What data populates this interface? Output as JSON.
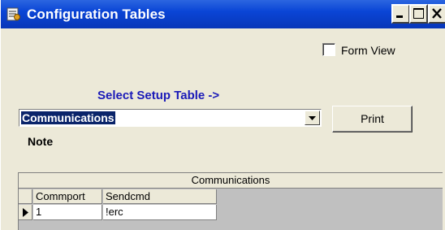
{
  "window": {
    "title": "Configuration Tables",
    "controls": {
      "minimize": "minimize",
      "maximize": "maximize",
      "close": "close"
    }
  },
  "form_view": {
    "label": "Form View",
    "checked": false
  },
  "setup": {
    "label": "Select Setup Table ->",
    "selected_value": "Communications"
  },
  "print_button": {
    "label": "Print"
  },
  "note": {
    "label": "Note"
  },
  "grid": {
    "caption": "Communications",
    "columns": [
      "Commport",
      "Sendcmd"
    ],
    "rows": [
      [
        "1",
        "!erc"
      ]
    ]
  },
  "colors": {
    "titlebar": "#0a45d6",
    "window_bg": "#ece9d8",
    "setup_label": "#1a1ab8",
    "selection": "#0a246a"
  },
  "icons": {
    "title": "table-config-icon",
    "row_indicator": "current-row-arrow-icon",
    "dropdown": "chevron-down-icon"
  }
}
